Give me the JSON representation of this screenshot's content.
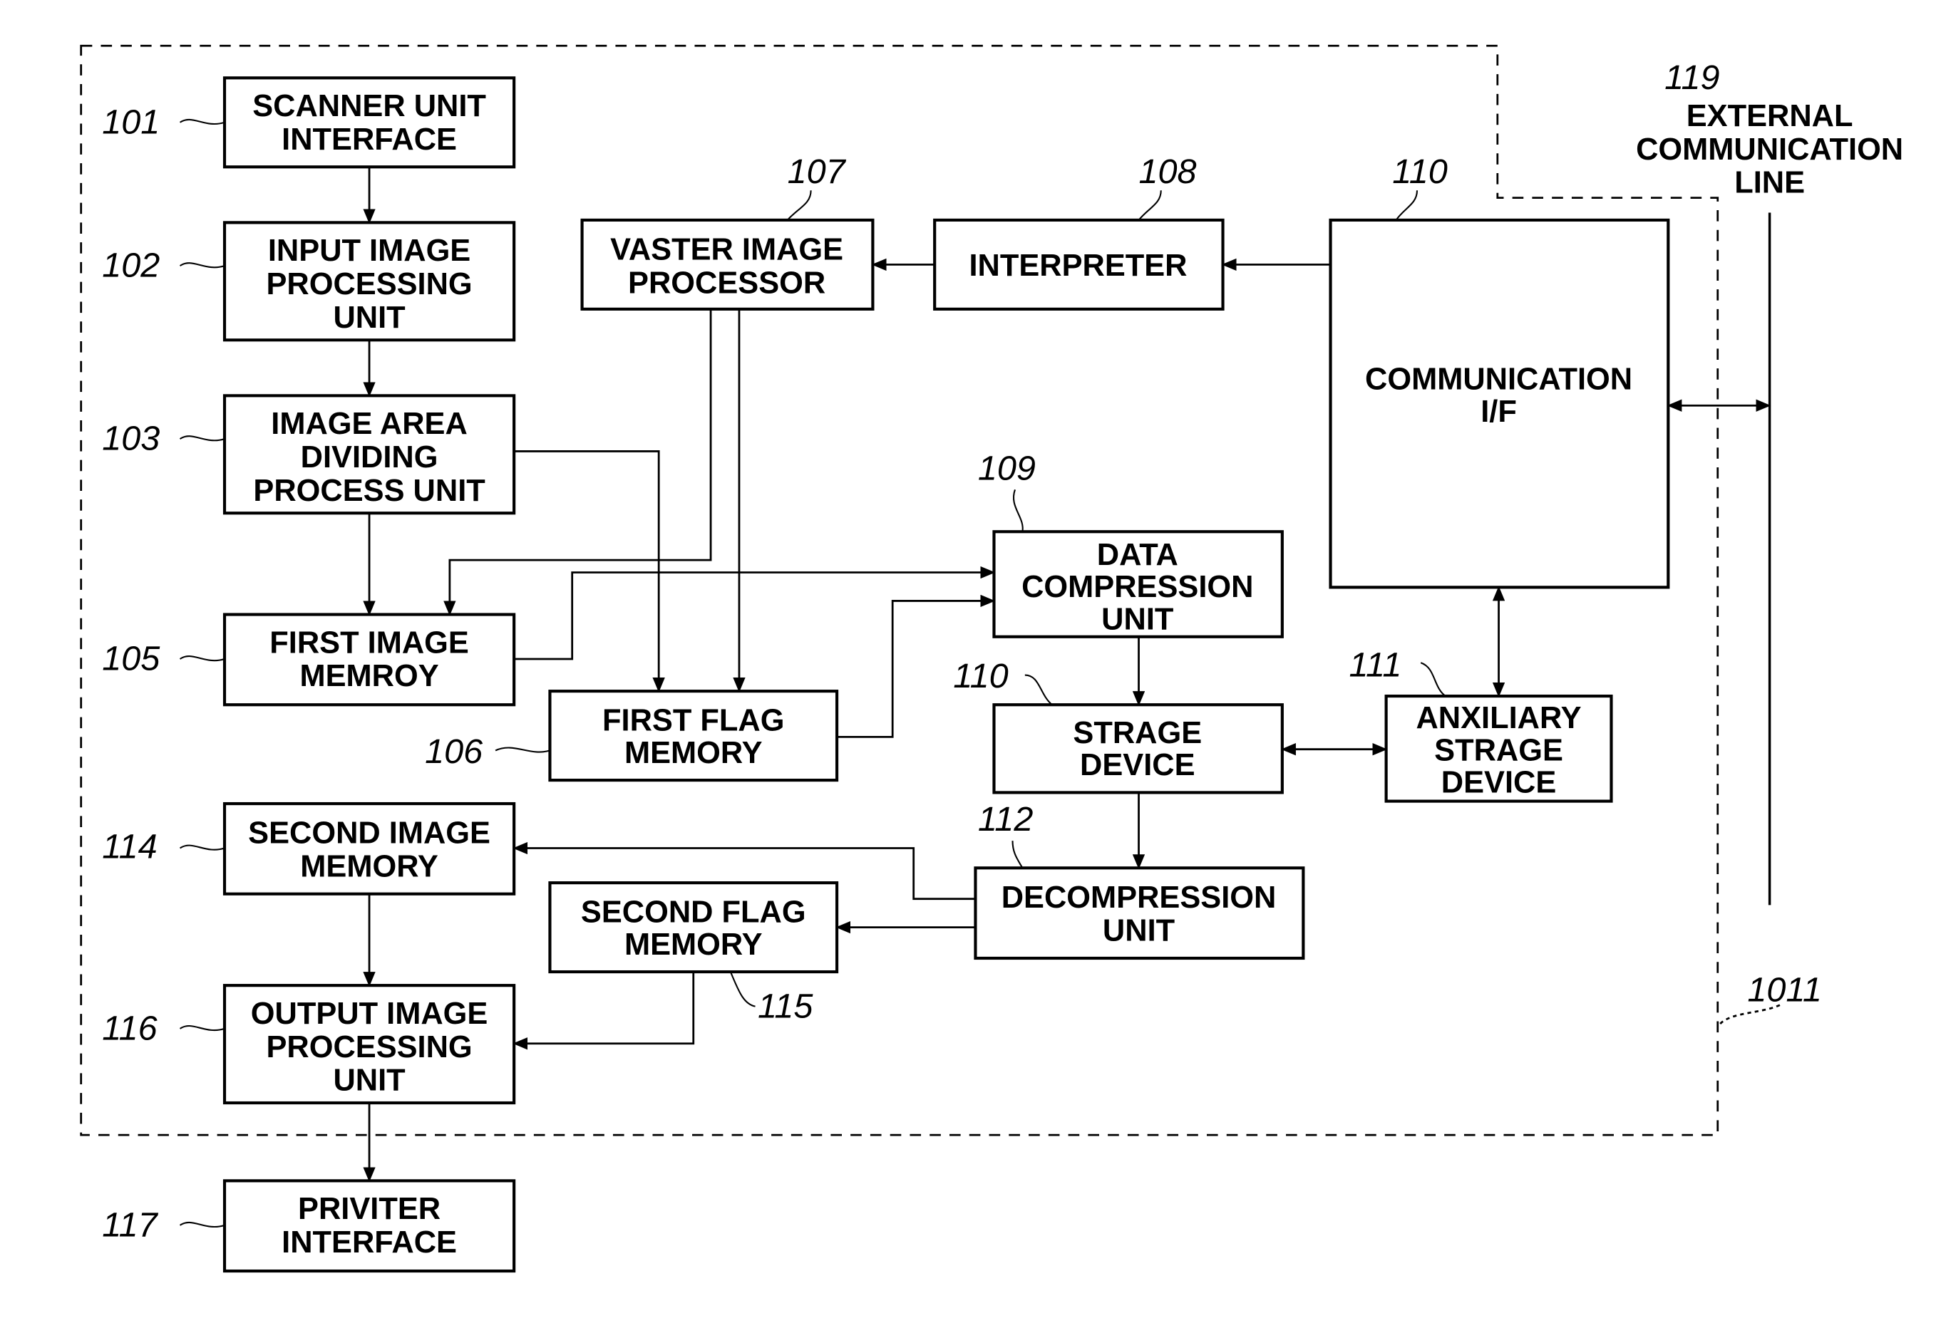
{
  "figure": {
    "type": "block-diagram",
    "boundary_ref": "1011",
    "blocks": [
      {
        "id": "101",
        "ref": "101",
        "lines": [
          "SCANNER UNIT",
          "INTERFACE"
        ]
      },
      {
        "id": "102",
        "ref": "102",
        "lines": [
          "INPUT IMAGE",
          "PROCESSING",
          "UNIT"
        ]
      },
      {
        "id": "103",
        "ref": "103",
        "lines": [
          "IMAGE AREA",
          "DIVIDING",
          "PROCESS UNIT"
        ]
      },
      {
        "id": "105",
        "ref": "105",
        "lines": [
          "FIRST IMAGE",
          "MEMROY"
        ]
      },
      {
        "id": "106",
        "ref": "106",
        "lines": [
          "FIRST FLAG",
          "MEMORY"
        ]
      },
      {
        "id": "107",
        "ref": "107",
        "lines": [
          "VASTER IMAGE",
          "PROCESSOR"
        ]
      },
      {
        "id": "108",
        "ref": "108",
        "lines": [
          "INTERPRETER"
        ]
      },
      {
        "id": "109",
        "ref": "109",
        "lines": [
          "DATA",
          "COMPRESSION",
          "UNIT"
        ]
      },
      {
        "id": "110a",
        "ref": "110",
        "lines": [
          "COMMUNICATION",
          "I/F"
        ]
      },
      {
        "id": "110b",
        "ref": "110",
        "lines": [
          "STRAGE",
          "DEVICE"
        ]
      },
      {
        "id": "111",
        "ref": "111",
        "lines": [
          "ANXILIARY",
          "STRAGE",
          "DEVICE"
        ]
      },
      {
        "id": "112",
        "ref": "112",
        "lines": [
          "DECOMPRESSION",
          "UNIT"
        ]
      },
      {
        "id": "114",
        "ref": "114",
        "lines": [
          "SECOND IMAGE",
          "MEMORY"
        ]
      },
      {
        "id": "115",
        "ref": "115",
        "lines": [
          "SECOND FLAG",
          "MEMORY"
        ]
      },
      {
        "id": "116",
        "ref": "116",
        "lines": [
          "OUTPUT IMAGE",
          "PROCESSING",
          "UNIT"
        ]
      },
      {
        "id": "117",
        "ref": "117",
        "lines": [
          "PRIVITER",
          "INTERFACE"
        ]
      }
    ],
    "external": {
      "ref": "119",
      "lines": [
        "EXTERNAL",
        "COMMUNICATION",
        "LINE"
      ]
    },
    "connections": [
      {
        "from": "101",
        "to": "102"
      },
      {
        "from": "102",
        "to": "103"
      },
      {
        "from": "103",
        "to": "105"
      },
      {
        "from": "103",
        "to": "106"
      },
      {
        "from": "107",
        "to": "105"
      },
      {
        "from": "107",
        "to": "106"
      },
      {
        "from": "108",
        "to": "107"
      },
      {
        "from": "110a",
        "to": "108"
      },
      {
        "from": "105",
        "to": "109"
      },
      {
        "from": "106",
        "to": "109"
      },
      {
        "from": "109",
        "to": "110b"
      },
      {
        "from": "110b",
        "to": "111",
        "bidirectional": true
      },
      {
        "from": "110a",
        "to": "111",
        "bidirectional": true
      },
      {
        "from": "110a",
        "to": "119",
        "bidirectional": true
      },
      {
        "from": "110b",
        "to": "112"
      },
      {
        "from": "112",
        "to": "114"
      },
      {
        "from": "112",
        "to": "115"
      },
      {
        "from": "114",
        "to": "116"
      },
      {
        "from": "115",
        "to": "116"
      },
      {
        "from": "116",
        "to": "117"
      }
    ]
  }
}
